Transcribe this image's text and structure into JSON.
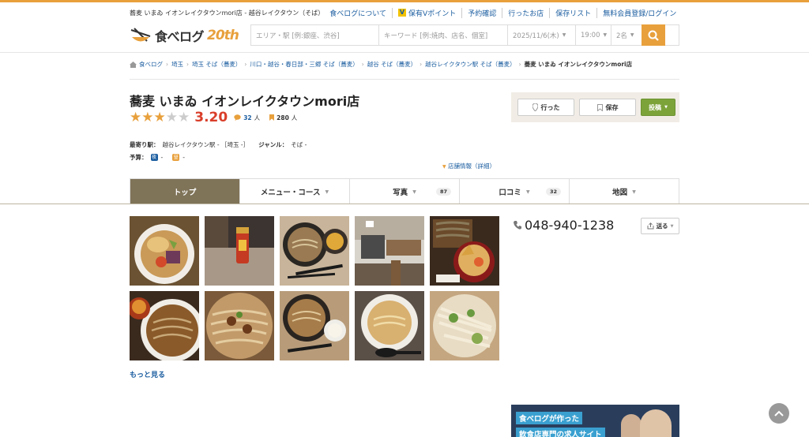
{
  "header": {
    "site_title": "蕎麦 いまゐ イオンレイクタウンmori店 - 越谷レイクタウン（そば）",
    "links": [
      "食べログについて",
      "保有Vポイント",
      "予約確認",
      "行ったお店",
      "保存リスト",
      "無料会員登録/ログイン"
    ],
    "vpoint_icon_label": "V",
    "logo_text": "食べログ",
    "logo_anniv": "20th"
  },
  "search": {
    "area_placeholder": "エリア・駅 [例:銀座、渋谷]",
    "keyword_placeholder": "キーワード [例:焼肉、店名、個室]",
    "date": "2025/11/6(木)",
    "time": "19:00",
    "people": "2名"
  },
  "breadcrumb": {
    "items": [
      "食べログ",
      "埼玉",
      "埼玉 そば（蕎麦）",
      "川口・越谷・春日部・三郷 そば（蕎麦）",
      "越谷 そば（蕎麦）",
      "越谷レイクタウン駅 そば（蕎麦）"
    ],
    "current": "蕎麦 いまゐ イオンレイクタウンmori店"
  },
  "restaurant": {
    "name": "蕎麦 いまゐ イオンレイクタウンmori店",
    "rating": 3.2,
    "rating_text": "3.20",
    "stars_filled": 3,
    "stars_total": 5,
    "review_count": "32",
    "review_unit": "人",
    "save_count": "280",
    "save_unit": "人",
    "station_label": "最寄り駅：",
    "station_value": "越谷レイクタウン駅 - ［埼玉 -］",
    "genre_label": "ジャンル：",
    "genre_value": "そば -",
    "budget_label": "予算：",
    "budget_night_icon": "夜",
    "budget_night": "-",
    "budget_day_icon": "昼",
    "budget_day": "-",
    "detail_link": "店舗情報（詳細）"
  },
  "actions": {
    "went": "行った",
    "save": "保存",
    "post": "投稿"
  },
  "tabs": [
    {
      "label": "トップ",
      "badge": ""
    },
    {
      "label": "メニュー・コース",
      "badge": ""
    },
    {
      "label": "写真",
      "badge": "87"
    },
    {
      "label": "口コミ",
      "badge": "32"
    },
    {
      "label": "地図",
      "badge": ""
    }
  ],
  "gallery": {
    "more_link": "もっと見る"
  },
  "contact": {
    "phone": "048-940-1238",
    "send_label": "送る"
  },
  "banner": {
    "line1": "食べログが作った",
    "line2": "飲食店専門の求人サイト"
  },
  "colors": {
    "accent": "#e8a03c",
    "link": "#1c5ea0",
    "score": "#d93e2a",
    "tab_active": "#7f7358",
    "post_button": "#7ca33a"
  }
}
